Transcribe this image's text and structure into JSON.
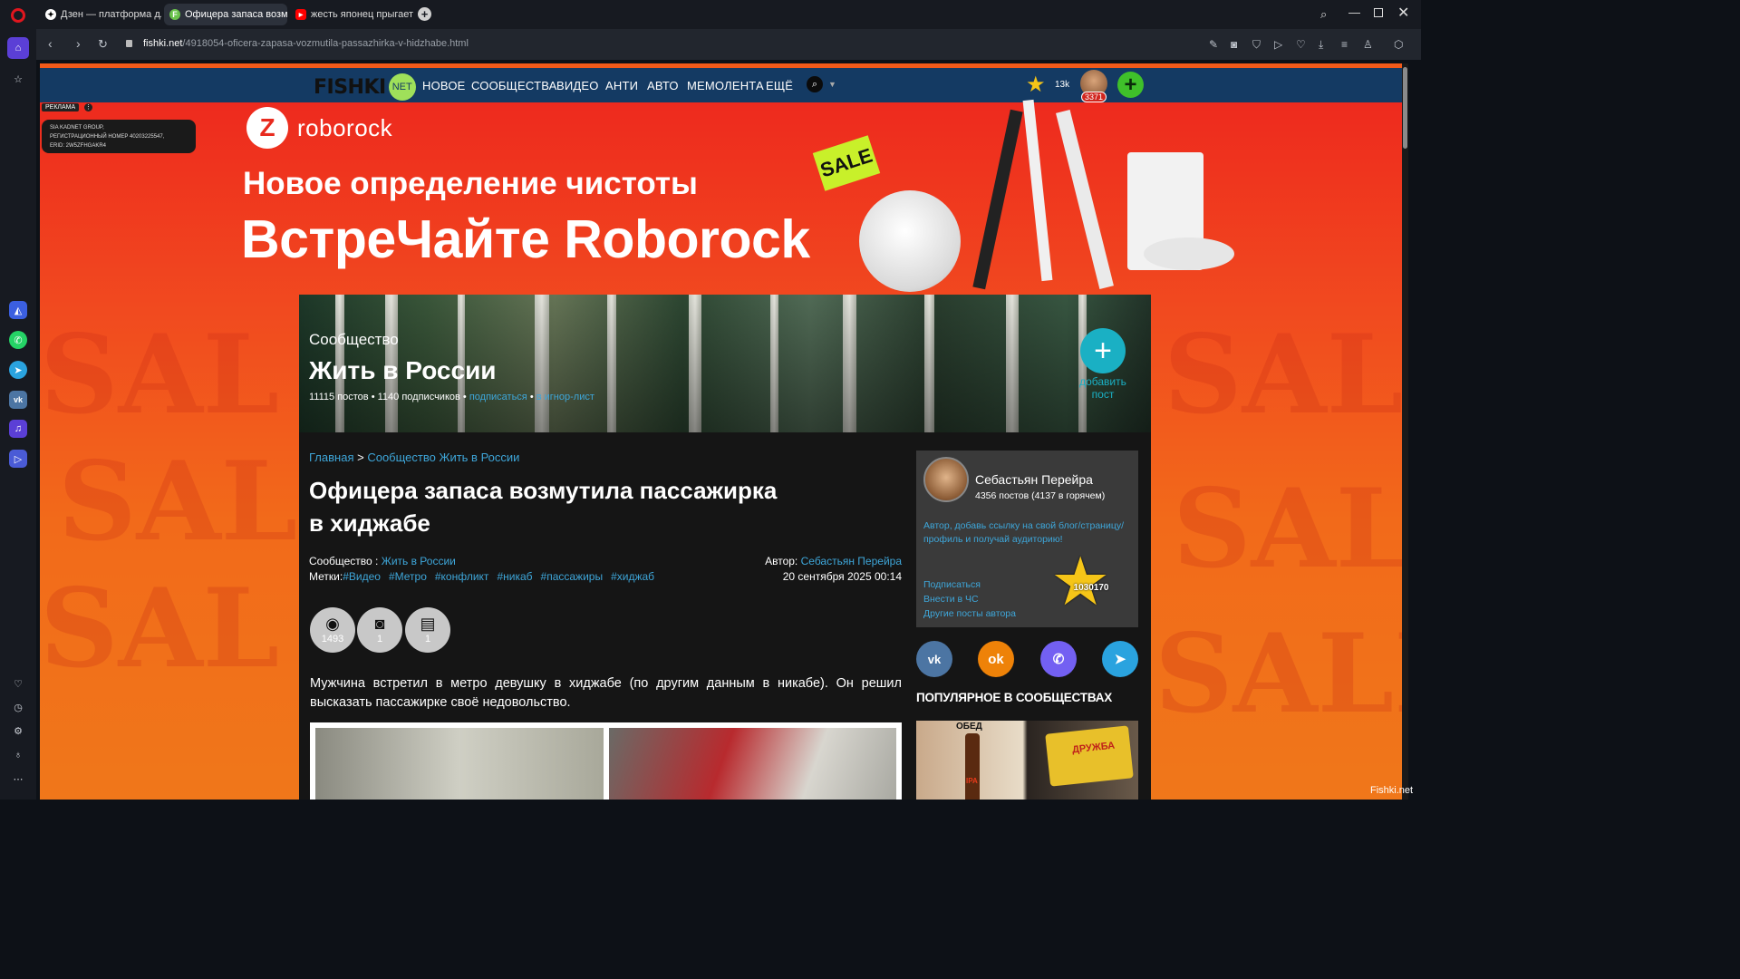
{
  "browser": {
    "tabs": [
      {
        "label": "Дзен — платформа для п",
        "icon": "dzen-icon"
      },
      {
        "label": "Офицера запаса возмути",
        "icon": "fishki-favicon",
        "active": true
      },
      {
        "label": "жесть японец прыгает с",
        "icon": "youtube-icon"
      }
    ],
    "new_tab": "+",
    "url_domain": "fishki.net",
    "url_path": "/4918054-oficera-zapasa-vozmutila-passazhirka-v-hidzhabe.html"
  },
  "site": {
    "logo_text": "FISHKI",
    "logo_badge": "NET",
    "nav": [
      "НОВОЕ",
      "СООБЩЕСТВА",
      "ВИДЕО",
      "АНТИ",
      "АВТО",
      "МЕМОЛЕНТА",
      "ЕЩЁ"
    ],
    "rating_count": "13k",
    "user_badge": "3371",
    "search_icon": "search-icon",
    "add_icon": "plus-icon"
  },
  "ad": {
    "label": "РЕКЛАМА",
    "info_icon": "⋮",
    "disclaimer_line1": "SIA KADNET GROUP,",
    "disclaimer_line2": "РЕГИСТРАЦИОННЫЙ НОМЕР 40203225547,",
    "disclaimer_line3": "ERID: 2W5ZFHGAKR4",
    "brand": "roborock",
    "headline": "Новое определение чистоты",
    "tagline": "ВстреЧайте Roborock",
    "sale_badge": "SALE"
  },
  "community": {
    "label": "Сообщество",
    "name": "Жить в России",
    "posts": "11115 постов",
    "subscribers": "1140 подписчиков",
    "subscribe_link": "подписаться",
    "ignore_link": "в игнор-лист",
    "add_post_line1": "добавить",
    "add_post_line2": "пост"
  },
  "breadcrumb": {
    "home": "Главная",
    "separator": ">",
    "current": "Сообщество Жить в России"
  },
  "article": {
    "title_line1": "Офицера запаса возмутила пассажирка",
    "title_line2": "в хиджабе",
    "community_label": "Сообщество :",
    "community_value": "Жить в России",
    "tags_label": "Метки:",
    "tags": [
      "#Видео",
      "#Метро",
      "#конфликт",
      "#никаб",
      "#пассажиры",
      "#хиджаб"
    ],
    "author_label": "Автор:",
    "author_value": "Себастьян Перейра",
    "date": "20 сентября 2025 00:14",
    "stats": {
      "views": "1493",
      "photos": "1",
      "videos": "1"
    },
    "body": "Мужчина встретил в метро девушку в хиджабе (по другим данным в никабе). Он решил высказать пассажирке своё недовольство."
  },
  "author_card": {
    "name": "Себастьян Перейра",
    "stats": "4356 постов (4137 в горячем)",
    "promo_line1": "Автор, добавь ссылку на свой блог/страницу/",
    "promo_line2": "профиль и получай аудиторию!",
    "links": [
      "Подписаться",
      "Внести в ЧС",
      "Другие посты автора"
    ],
    "rating": "1030170"
  },
  "social": [
    {
      "name": "vk",
      "glyph": "vk",
      "color": "#4c75a3"
    },
    {
      "name": "ok",
      "glyph": "ok",
      "color": "#ee8208"
    },
    {
      "name": "viber",
      "glyph": "✆",
      "color": "#7360f2"
    },
    {
      "name": "telegram",
      "glyph": "➤",
      "color": "#2aa3df"
    }
  ],
  "popular": {
    "heading": "ПОПУЛЯРНОЕ В СООБЩЕСТВАХ",
    "thumb_caption": "ОБЕД",
    "thumb_label": "ДРУЖБА",
    "bottle_label": "IPA"
  },
  "watermark": "Fishki.net"
}
